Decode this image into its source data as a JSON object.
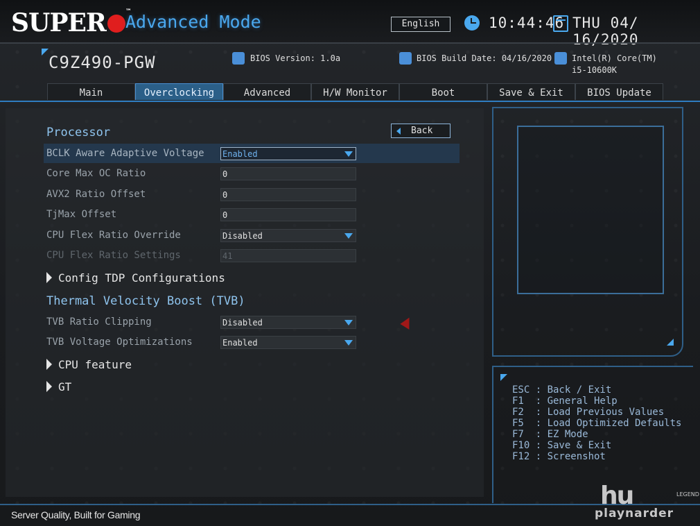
{
  "header": {
    "brand": "SUPER",
    "mode_title": "Advanced Mode",
    "language": "English",
    "time": "10:44:46",
    "date": "THU 04/ 16/2020"
  },
  "system": {
    "model": "C9Z490-PGW",
    "bios_version": "BIOS Version: 1.0a",
    "build_date": "BIOS Build Date: 04/16/2020",
    "cpu_line1": "Intel(R) Core(TM)",
    "cpu_line2": "i5-10600K"
  },
  "tabs": [
    {
      "label": "Main",
      "active": false
    },
    {
      "label": "Overclocking",
      "active": true
    },
    {
      "label": "Advanced",
      "active": false
    },
    {
      "label": "H/W Monitor",
      "active": false
    },
    {
      "label": "Boot",
      "active": false
    },
    {
      "label": "Save & Exit",
      "active": false
    },
    {
      "label": "BIOS Update",
      "active": false
    }
  ],
  "main": {
    "section_processor": "Processor",
    "back_label": "Back",
    "settings": [
      {
        "label": "BCLK Aware Adaptive Voltage",
        "value": "Enabled"
      },
      {
        "label": "Core Max OC Ratio",
        "value": "0"
      },
      {
        "label": "AVX2 Ratio Offset",
        "value": "0"
      },
      {
        "label": "TjMax Offset",
        "value": "0"
      },
      {
        "label": "CPU Flex Ratio Override",
        "value": "Disabled"
      },
      {
        "label": "CPU Flex Ratio Settings",
        "value": "41"
      }
    ],
    "submenu_config_tdp": "Config TDP Configurations",
    "section_tvb": "Thermal Velocity Boost (TVB)",
    "tvb_settings": [
      {
        "label": "TVB Ratio Clipping",
        "value": "Disabled"
      },
      {
        "label": "TVB Voltage Optimizations",
        "value": "Enabled"
      }
    ],
    "submenu_cpu_feature": "CPU feature",
    "submenu_gt": "GT"
  },
  "help": [
    "ESC : Back / Exit",
    "F1  : General Help",
    "F2  : Load Previous Values",
    "F5  : Load Optimized Defaults",
    "F7  : EZ Mode",
    "F10 : Save & Exit",
    "F12 : Screenshot"
  ],
  "footer": {
    "slogan": "Server Quality, Built for Gaming"
  },
  "watermark": {
    "big": "hu",
    "small": "playnarder",
    "tag": "LEGEND"
  },
  "colors": {
    "accent": "#4aa8ee",
    "brand_red": "#e01e1e",
    "active_tab": "#2b5f88",
    "highlight_row": "#24384d"
  }
}
